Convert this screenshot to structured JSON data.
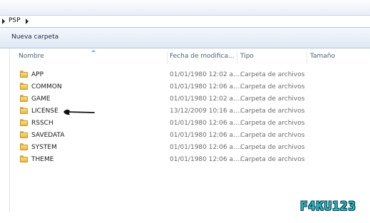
{
  "address_bar": {
    "crumb": "PSP"
  },
  "toolbar": {
    "new_folder_label": "Nueva carpeta"
  },
  "columns": {
    "name": "Nombre",
    "date": "Fecha de modifica...",
    "type": "Tipo",
    "size": "Tamaño"
  },
  "folders": [
    {
      "name": "APP",
      "date": "01/01/1980 12:02 a....",
      "type": "Carpeta de archivos"
    },
    {
      "name": "COMMON",
      "date": "01/01/1980 12:06 a....",
      "type": "Carpeta de archivos"
    },
    {
      "name": "GAME",
      "date": "01/01/1980 12:02 a....",
      "type": "Carpeta de archivos"
    },
    {
      "name": "LICENSE",
      "date": "13/12/2009 10:16 a....",
      "type": "Carpeta de archivos"
    },
    {
      "name": "RSSCH",
      "date": "01/01/1980 12:06 a....",
      "type": "Carpeta de archivos"
    },
    {
      "name": "SAVEDATA",
      "date": "01/01/1980 12:06 a....",
      "type": "Carpeta de archivos"
    },
    {
      "name": "SYSTEM",
      "date": "01/01/1980 12:06 a....",
      "type": "Carpeta de archivos"
    },
    {
      "name": "THEME",
      "date": "01/01/1980 12:06 a....",
      "type": "Carpeta de archivos"
    }
  ],
  "icons": {
    "folder": "folder-icon",
    "annotation": "hand-drawn-arrow"
  },
  "watermark": "F4KU123",
  "colors": {
    "accent": "#2ab9c5",
    "folder": "#e8b73e",
    "header_text": "#4c607a"
  }
}
